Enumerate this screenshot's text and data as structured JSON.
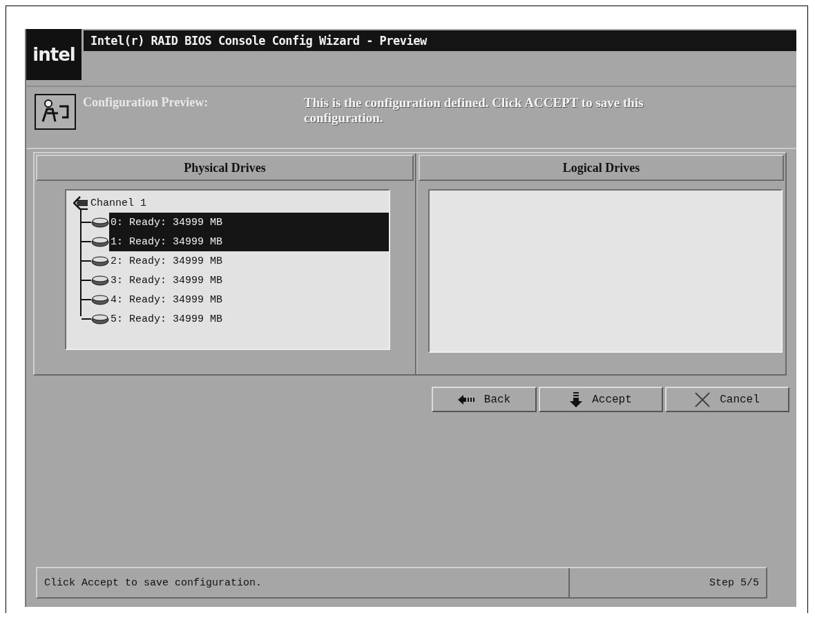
{
  "logo": {
    "text": "intel"
  },
  "window": {
    "title": "Intel(r) RAID BIOS Console Config Wizard - Preview"
  },
  "section": {
    "label": "Configuration Preview:",
    "description": "This is the configuration defined. Click ACCEPT to save this configuration."
  },
  "panels": [
    {
      "title": "Physical Drives"
    },
    {
      "title": "Logical Drives"
    }
  ],
  "tree": {
    "label": "Channel 1",
    "expanded": true,
    "children": [
      {
        "label": "0: Ready: 34999 MB",
        "selected": true
      },
      {
        "label": "1: Ready: 34999 MB",
        "selected": true
      },
      {
        "label": "2: Ready: 34999 MB",
        "selected": false
      },
      {
        "label": "3: Ready: 34999 MB",
        "selected": false
      },
      {
        "label": "4: Ready: 34999 MB",
        "selected": false
      },
      {
        "label": "5: Ready: 34999 MB",
        "selected": false
      }
    ]
  },
  "buttons": [
    {
      "kind": "back",
      "label": "Back"
    },
    {
      "kind": "accept",
      "label": "Accept"
    },
    {
      "kind": "cancel",
      "label": "Cancel"
    }
  ],
  "status_bar": {
    "message": "Click Accept to save configuration.",
    "step": "Step 5/5"
  }
}
